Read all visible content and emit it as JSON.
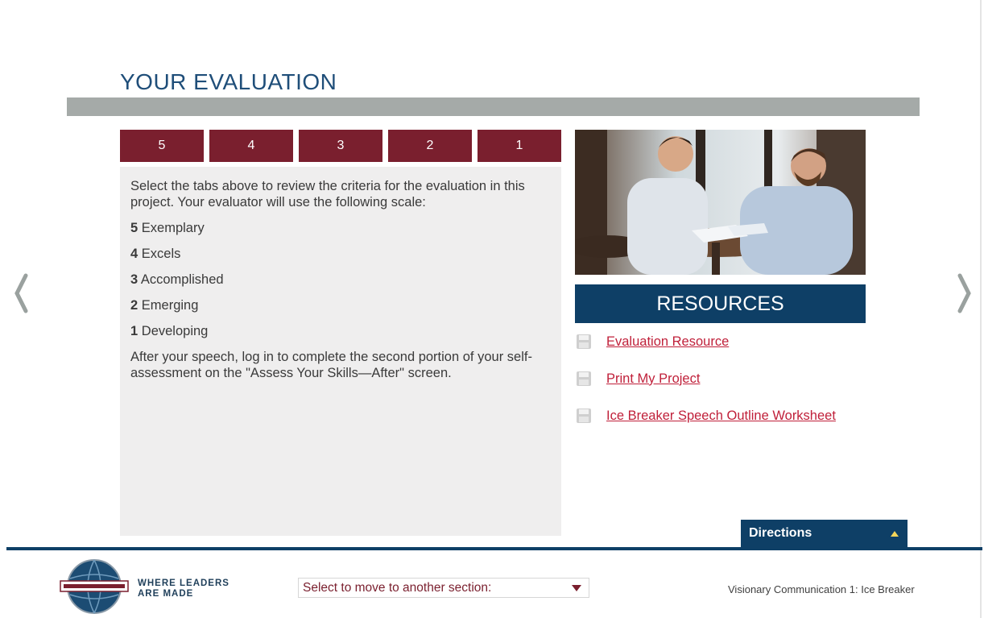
{
  "page": {
    "title": "YOUR EVALUATION"
  },
  "tabs": [
    "5",
    "4",
    "3",
    "2",
    "1"
  ],
  "content": {
    "intro": "Select the tabs above to review the criteria for the evaluation in this project. Your evaluator will use the following scale:",
    "scale": [
      {
        "score": "5",
        "label": "Exemplary"
      },
      {
        "score": "4",
        "label": "Excels"
      },
      {
        "score": "3",
        "label": "Accomplished"
      },
      {
        "score": "2",
        "label": "Emerging"
      },
      {
        "score": "1",
        "label": "Developing"
      }
    ],
    "closing": "After your speech, log in to complete the second portion of your self-assessment on the \"Assess Your Skills—After\" screen."
  },
  "resources": {
    "heading": "RESOURCES",
    "items": [
      {
        "label": "Evaluation Resource",
        "icon": "save-icon"
      },
      {
        "label": "Print My Project",
        "icon": "save-icon"
      },
      {
        "label": "Ice Breaker Speech Outline Worksheet",
        "icon": "save-icon"
      }
    ]
  },
  "directions": {
    "label": "Directions"
  },
  "footer": {
    "tagline_line1": "WHERE LEADERS",
    "tagline_line2": "ARE MADE",
    "select_placeholder": "Select to move to another section:",
    "project_name": "Visionary Communication 1: Ice Breaker"
  },
  "colors": {
    "accent": "#7a1f2e",
    "navy": "#0e3f66",
    "title_blue": "#1f4e79",
    "link_red": "#c0203a",
    "panel_bg": "#efeeee"
  }
}
